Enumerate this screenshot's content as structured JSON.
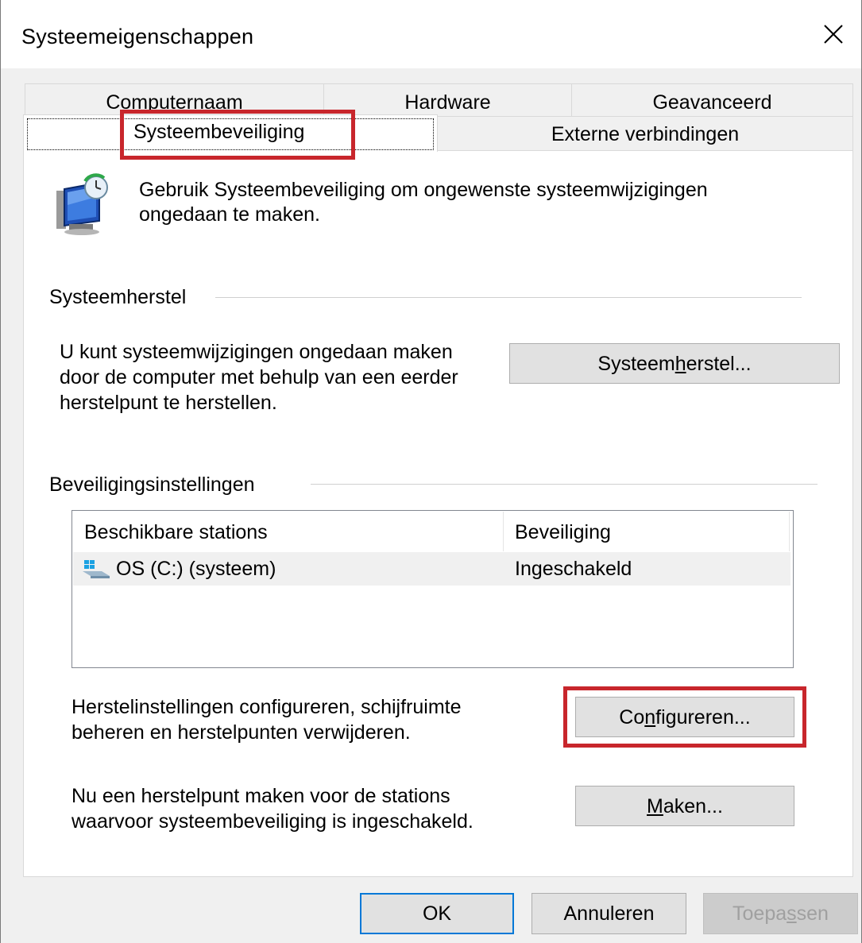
{
  "window": {
    "title": "Systeemeigenschappen"
  },
  "tabs": {
    "row1": [
      "Computernaam",
      "Hardware",
      "Geavanceerd"
    ],
    "row2": [
      "Systeembeveiliging",
      "Externe verbindingen"
    ],
    "active": "Systeembeveiliging"
  },
  "intro": {
    "text_line1": "Gebruik Systeembeveiliging om ongewenste systeemwijzigingen",
    "text_line2": "ongedaan te maken."
  },
  "restore_group": {
    "title": "Systeemherstel",
    "desc_line1": "U kunt systeemwijzigingen ongedaan maken",
    "desc_line2": "door de computer met behulp van een eerder",
    "desc_line3": "herstelpunt te herstellen.",
    "button_pre": "Systeem",
    "button_acc": "h",
    "button_post": "erstel..."
  },
  "protection_group": {
    "title": "Beveiligingsinstellingen",
    "columns": [
      "Beschikbare stations",
      "Beveiliging"
    ],
    "rows": [
      {
        "drive": "OS (C:) (systeem)",
        "protection": "Ingeschakeld"
      }
    ],
    "configure_desc_line1": "Herstelinstellingen configureren, schijfruimte",
    "configure_desc_line2": "beheren en herstelpunten verwijderen.",
    "configure_pre": "Co",
    "configure_acc": "n",
    "configure_post": "figureren...",
    "create_desc_line1": "Nu een herstelpunt maken voor de stations",
    "create_desc_line2": "waarvoor systeembeveiliging is ingeschakeld.",
    "create_pre": "",
    "create_acc": "M",
    "create_post": "aken..."
  },
  "footer": {
    "ok": "OK",
    "cancel": "Annuleren",
    "apply_pre": "Toepa",
    "apply_acc": "s",
    "apply_post": "sen"
  },
  "colors": {
    "highlight": "#c8262c",
    "focus_border": "#0078d7"
  }
}
